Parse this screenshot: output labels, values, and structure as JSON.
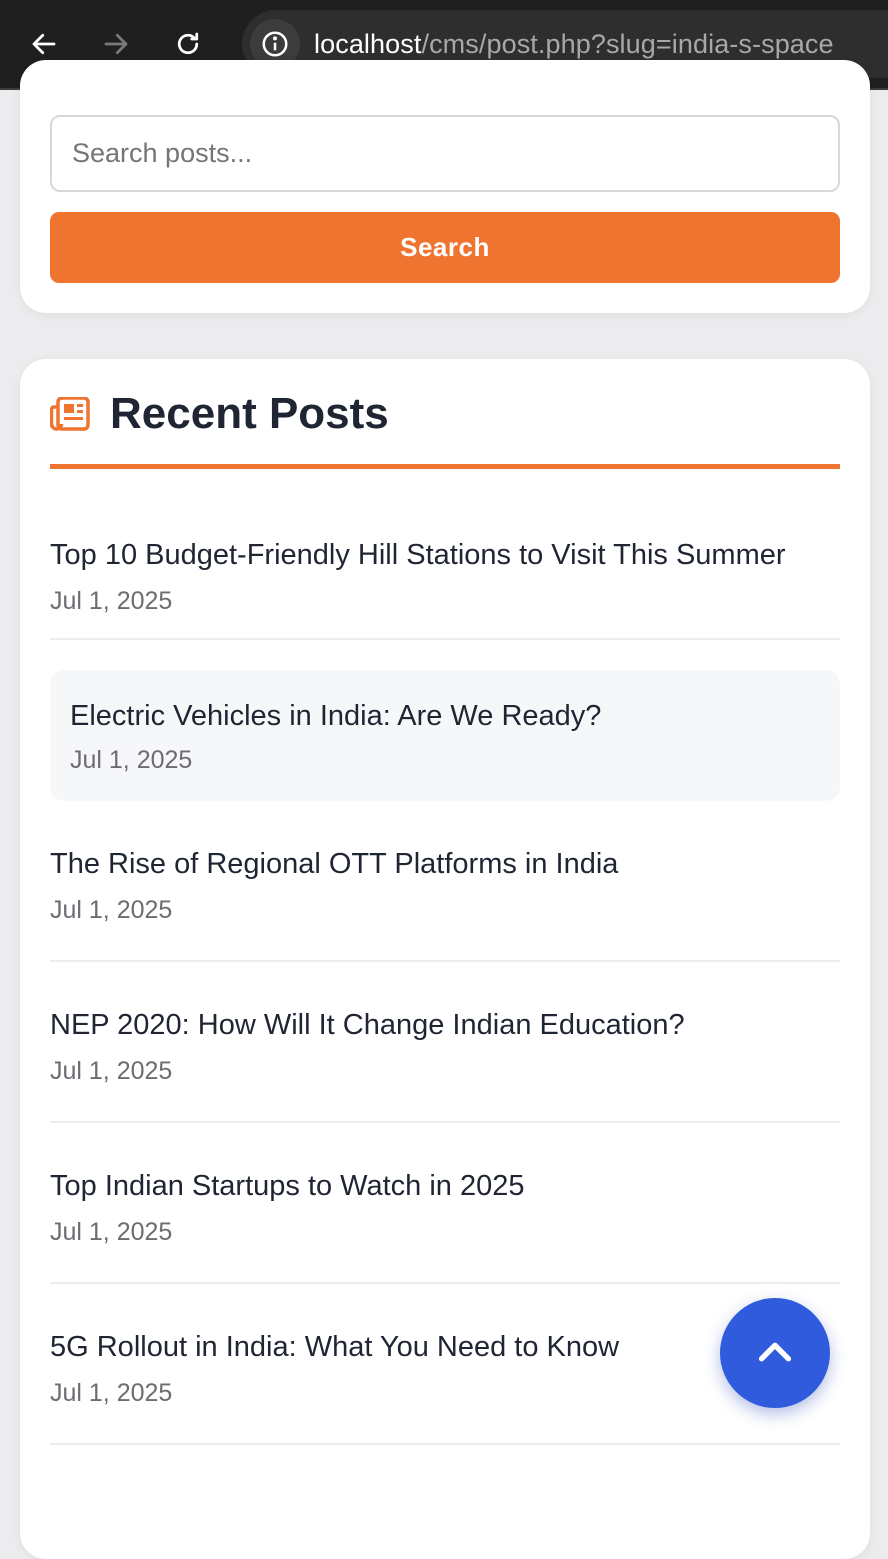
{
  "browser": {
    "url_host": "localhost",
    "url_path": "/cms/post.php?slug=india-s-space"
  },
  "search": {
    "placeholder": "Search posts...",
    "button_label": "Search"
  },
  "recent_posts": {
    "title": "Recent Posts",
    "items": [
      {
        "title": "Top 10 Budget-Friendly Hill Stations to Visit This Summer",
        "date": "Jul 1, 2025"
      },
      {
        "title": "Electric Vehicles in India: Are We Ready?",
        "date": "Jul 1, 2025"
      },
      {
        "title": "The Rise of Regional OTT Platforms in India",
        "date": "Jul 1, 2025"
      },
      {
        "title": "NEP 2020: How Will It Change Indian Education?",
        "date": "Jul 1, 2025"
      },
      {
        "title": "Top Indian Startups to Watch in 2025",
        "date": "Jul 1, 2025"
      },
      {
        "title": "5G Rollout in India: What You Need to Know",
        "date": "Jul 1, 2025"
      }
    ]
  },
  "colors": {
    "accent": "#ee7430",
    "scroll_button": "#2f5bdc"
  },
  "icons": {
    "back": "arrow-left-icon",
    "forward": "arrow-right-icon",
    "reload": "reload-icon",
    "site_info": "info-icon",
    "section": "newspaper-icon",
    "scroll_top": "chevron-up-icon"
  }
}
